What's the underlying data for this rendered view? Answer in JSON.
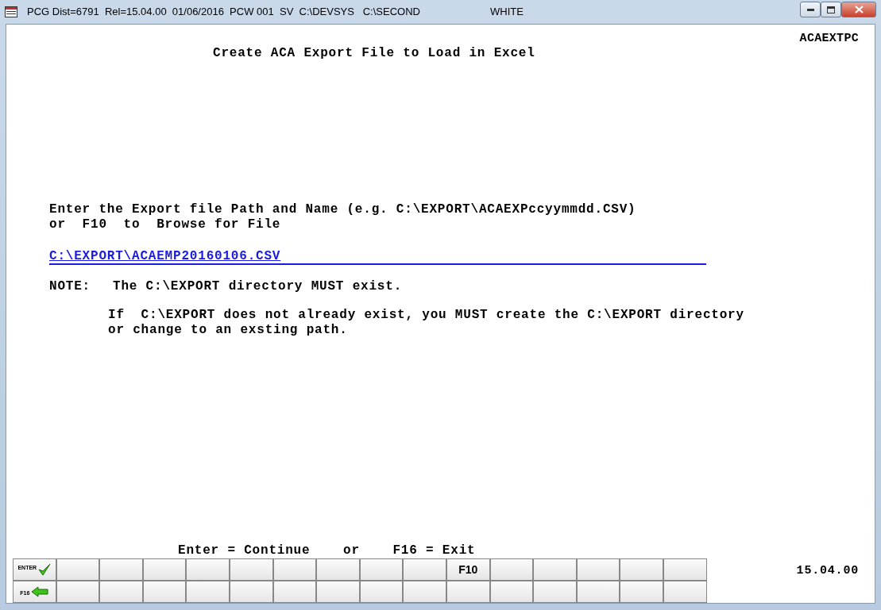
{
  "window": {
    "title": "PCG Dist=6791  Rel=15.04.00  01/06/2016  PCW 001  SV  C:\\DEVSYS   C:\\SECOND",
    "user": "WHITE"
  },
  "screen": {
    "program_id": "ACAEXTPC",
    "heading": "Create ACA Export File to Load in Excel",
    "instructions": [
      "Enter the Export file Path and Name (e.g. C:\\EXPORT\\ACAEXPccyymmdd.CSV)",
      "or  F10  to  Browse for File"
    ],
    "path_field": {
      "value": "C:\\EXPORT\\ACAEMP20160106.CSV"
    },
    "note_label": "NOTE:",
    "note": "The C:\\EXPORT directory MUST exist.",
    "note_detail": [
      "If  C:\\EXPORT does not already exist, you MUST create the C:\\EXPORT directory",
      "or change to an exsting path."
    ],
    "prompt": "Enter = Continue    or    F16 = Exit"
  },
  "function_keys": [
    [
      {
        "kind": "enter",
        "label": "ENTER"
      },
      {
        "kind": "blank"
      },
      {
        "kind": "blank"
      },
      {
        "kind": "blank"
      },
      {
        "kind": "blank"
      },
      {
        "kind": "blank"
      },
      {
        "kind": "blank"
      },
      {
        "kind": "blank"
      },
      {
        "kind": "blank"
      },
      {
        "kind": "blank"
      },
      {
        "kind": "text",
        "label": "F10"
      },
      {
        "kind": "blank"
      },
      {
        "kind": "blank"
      },
      {
        "kind": "blank"
      },
      {
        "kind": "blank"
      },
      {
        "kind": "blank"
      }
    ],
    [
      {
        "kind": "exit",
        "label": "F16"
      },
      {
        "kind": "blank"
      },
      {
        "kind": "blank"
      },
      {
        "kind": "blank"
      },
      {
        "kind": "blank"
      },
      {
        "kind": "blank"
      },
      {
        "kind": "blank"
      },
      {
        "kind": "blank"
      },
      {
        "kind": "blank"
      },
      {
        "kind": "blank"
      },
      {
        "kind": "blank"
      },
      {
        "kind": "blank"
      },
      {
        "kind": "blank"
      },
      {
        "kind": "blank"
      },
      {
        "kind": "blank"
      },
      {
        "kind": "blank"
      }
    ]
  ],
  "version": "15.04.00"
}
